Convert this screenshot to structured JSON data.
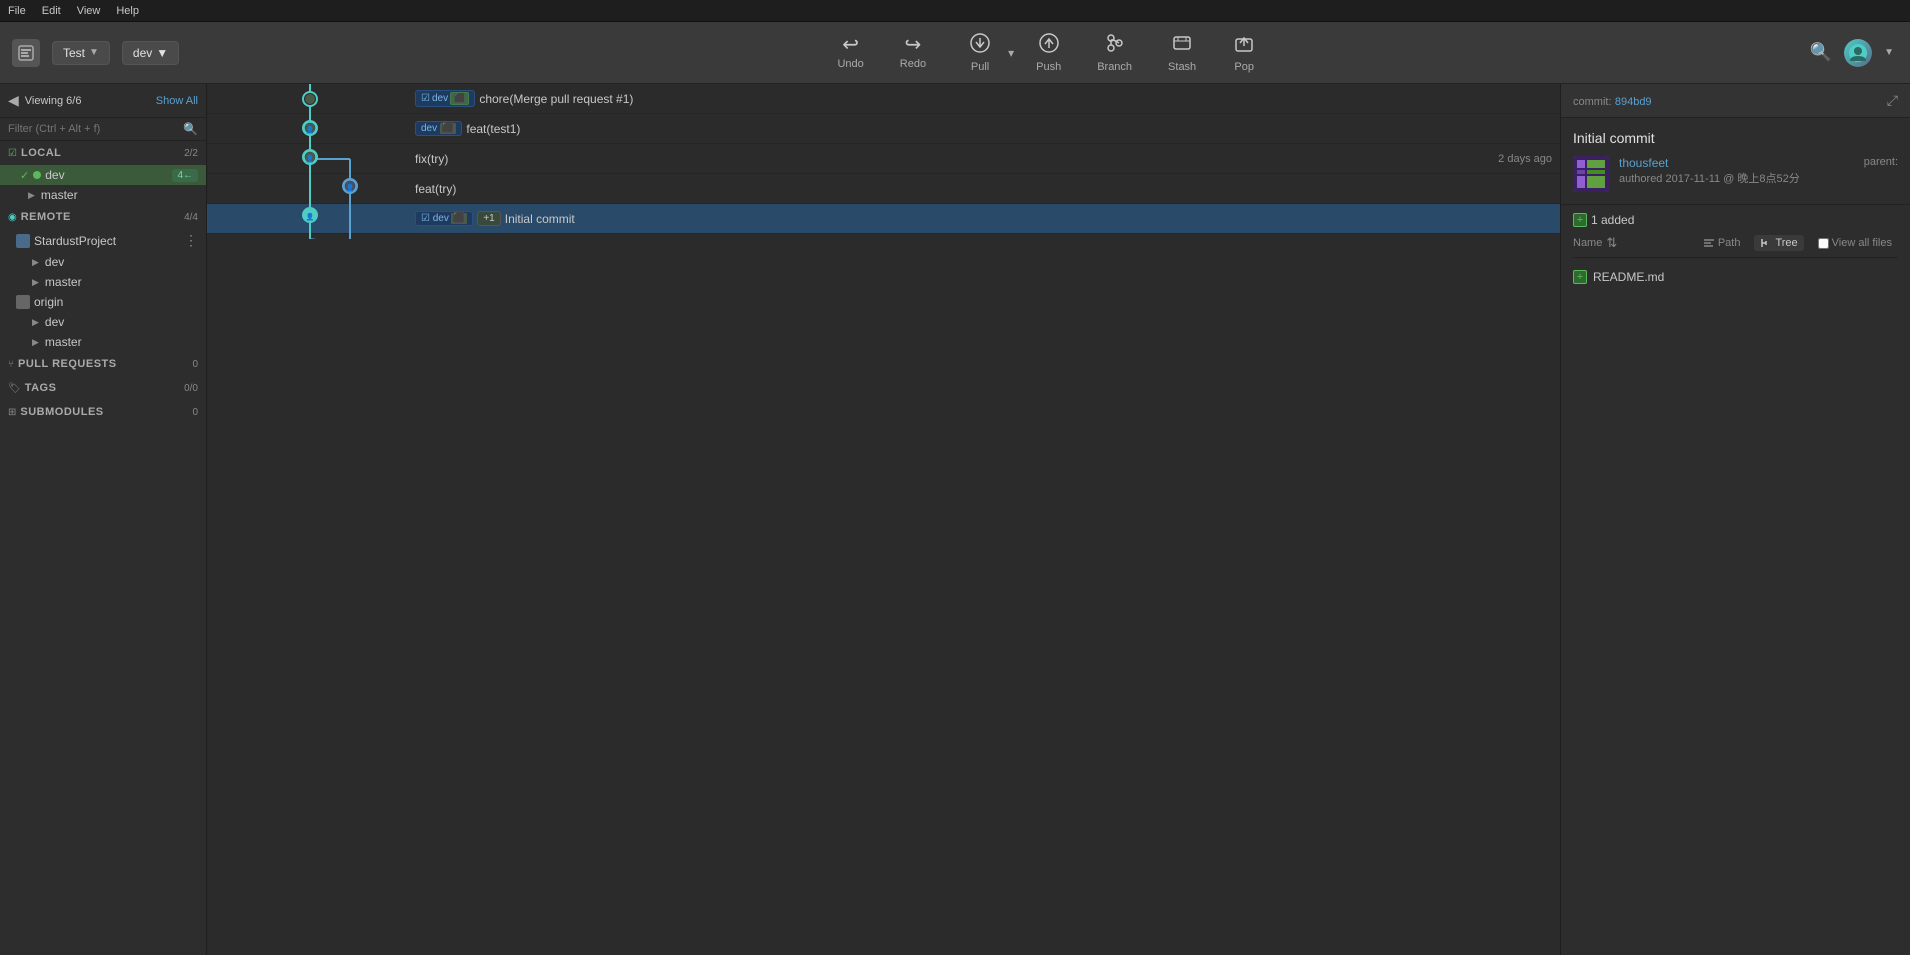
{
  "menu": {
    "items": [
      "File",
      "Edit",
      "View",
      "Help"
    ]
  },
  "toolbar": {
    "project_name": "Test",
    "branch_name": "dev",
    "tools": [
      {
        "id": "undo",
        "label": "Undo",
        "icon": "↩"
      },
      {
        "id": "redo",
        "label": "Redo",
        "icon": "↪"
      },
      {
        "id": "pull",
        "label": "Pull",
        "icon": "⬇",
        "has_split": true
      },
      {
        "id": "push",
        "label": "Push",
        "icon": "⬆"
      },
      {
        "id": "branch",
        "label": "Branch",
        "icon": "⑂"
      },
      {
        "id": "stash",
        "label": "Stash",
        "icon": "📦"
      },
      {
        "id": "pop",
        "label": "Pop",
        "icon": "📤"
      }
    ]
  },
  "sidebar": {
    "viewing_text": "Viewing 6/6",
    "show_all": "Show All",
    "filter_placeholder": "Filter (Ctrl + Alt + f)",
    "local_section": {
      "label": "LOCAL",
      "count": "2/2",
      "branches": [
        {
          "name": "dev",
          "active": true,
          "badge": "4←"
        },
        {
          "name": "master",
          "active": false
        }
      ]
    },
    "remote_section": {
      "label": "REMOTE",
      "count": "4/4",
      "repos": [
        {
          "name": "StardustProject",
          "branches": [
            "dev",
            "master"
          ]
        },
        {
          "name": "origin",
          "branches": [
            "dev",
            "master"
          ]
        }
      ]
    },
    "pull_requests": {
      "label": "PULL REQUESTS",
      "count": "0"
    },
    "tags": {
      "label": "TAGS",
      "count": "0/0"
    },
    "submodules": {
      "label": "SUBMODULES",
      "count": "0"
    }
  },
  "commits": [
    {
      "id": 1,
      "message": "chore(Merge pull request #1)",
      "branch_tags": [
        "dev"
      ],
      "time": "",
      "selected": false,
      "graph_type": "merge_top"
    },
    {
      "id": 2,
      "message": "feat(test1)",
      "branch_tags": [
        "dev"
      ],
      "time": "",
      "selected": false,
      "graph_type": "node"
    },
    {
      "id": 3,
      "message": "fix(try)",
      "branch_tags": [],
      "time": "2 days ago",
      "selected": false,
      "graph_type": "node"
    },
    {
      "id": 4,
      "message": "feat(try)",
      "branch_tags": [],
      "time": "",
      "selected": false,
      "graph_type": "node"
    },
    {
      "id": 5,
      "message": "Initial commit",
      "branch_tags": [
        "dev",
        "+1"
      ],
      "time": "",
      "selected": true,
      "graph_type": "bottom"
    }
  ],
  "right_panel": {
    "commit_label": "commit:",
    "commit_hash": "894bd9",
    "commit_title": "Initial commit",
    "parent_label": "parent:",
    "author": {
      "name": "thousfeet",
      "date": "authored 2017-11-11 @ 晚上8点52分"
    },
    "files_summary": "1 added",
    "sort_label": "Name",
    "view_path": "Path",
    "view_tree": "Tree",
    "view_all_label": "View all files",
    "files": [
      {
        "name": "README.md",
        "status": "added"
      }
    ]
  }
}
